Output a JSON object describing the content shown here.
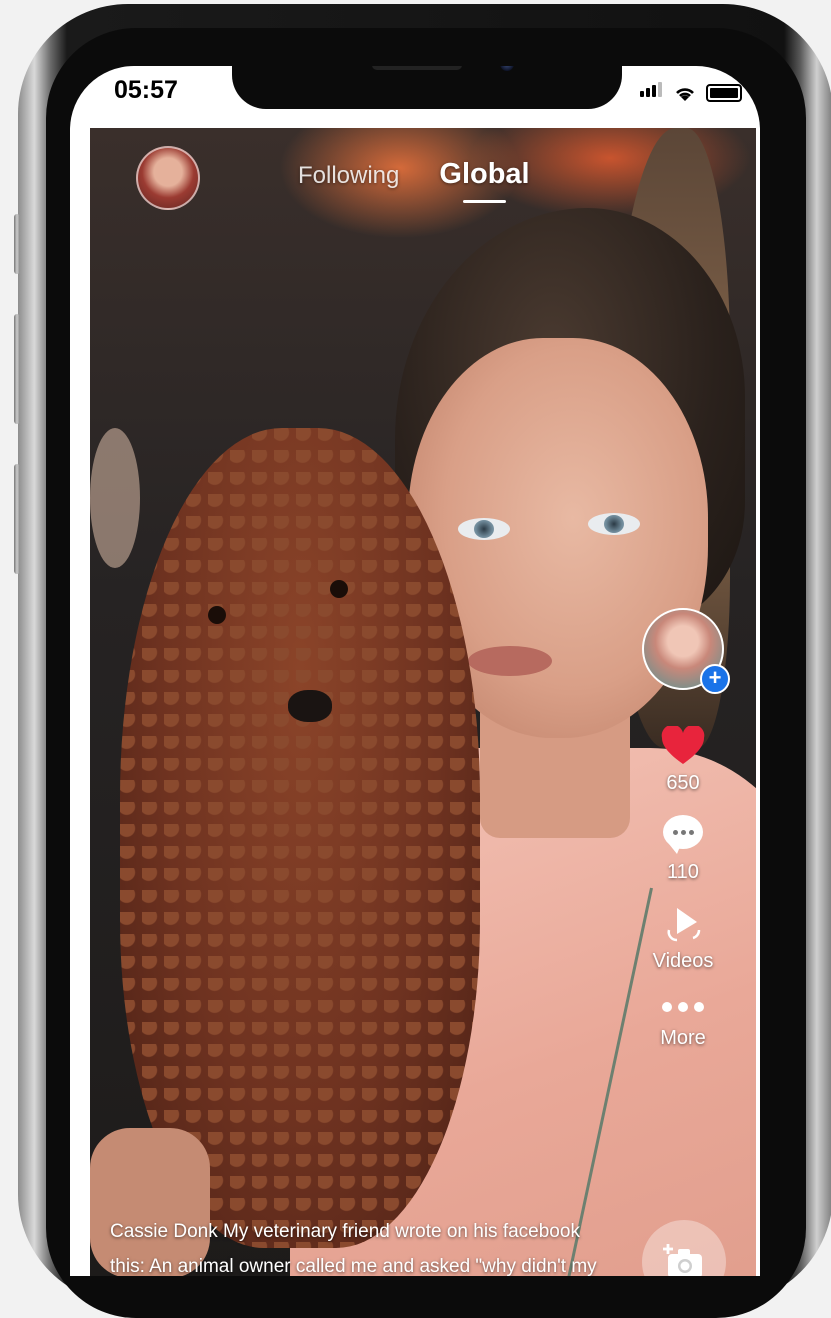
{
  "status_bar": {
    "time": "05:57"
  },
  "header": {
    "tabs": [
      {
        "label": "Following",
        "active": false
      },
      {
        "label": "Global",
        "active": true
      }
    ]
  },
  "rail": {
    "likes_count": "650",
    "comments_count": "110",
    "videos_label": "Videos",
    "more_label": "More",
    "follow_symbol": "+"
  },
  "post": {
    "author": "Cassie Donk",
    "caption": "My veterinary friend wrote on his facebook this: An animal owner called me and asked \"why didn't my cat eat his food today, he"
  },
  "colors": {
    "like_heart": "#e8243c",
    "follow_badge": "#1a73e8",
    "tab_text": "#ffffff"
  },
  "icons": [
    "signal-icon",
    "wifi-icon",
    "battery-icon",
    "heart-icon",
    "comment-icon",
    "videos-icon",
    "more-icon",
    "camera-add-icon"
  ]
}
